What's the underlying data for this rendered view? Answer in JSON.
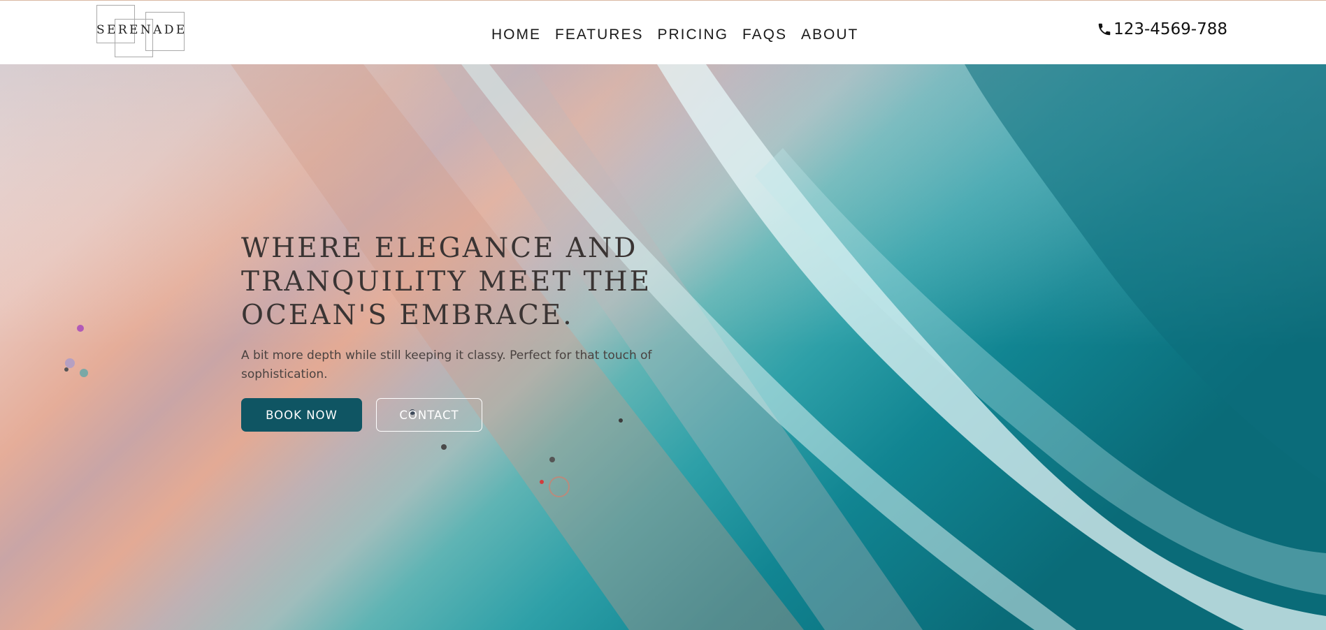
{
  "header": {
    "logo_text": "SERENADE",
    "nav": [
      {
        "label": "HOME"
      },
      {
        "label": "FEATURES"
      },
      {
        "label": "PRICING"
      },
      {
        "label": "FAQS"
      },
      {
        "label": "ABOUT"
      }
    ],
    "phone": {
      "icon": "phone-icon",
      "number": "123-4569-788"
    }
  },
  "hero": {
    "title_lines": [
      "WHERE ELEGANCE AND",
      "TRANQUILITY MEET THE",
      "OCEAN'S EMBRACE."
    ],
    "subtitle": "A bit more depth while still keeping it classy. Perfect for that touch of sophistication.",
    "primary_button": "BOOK NOW",
    "secondary_button": "CONTACT",
    "background": "aerial-beach-ocean-photo"
  },
  "colors": {
    "accent": "#0f5563",
    "title_text": "#3a3433",
    "header_border": "#d9b8a3",
    "sand": "#e6c6bb",
    "ocean": "#0e7a86"
  }
}
